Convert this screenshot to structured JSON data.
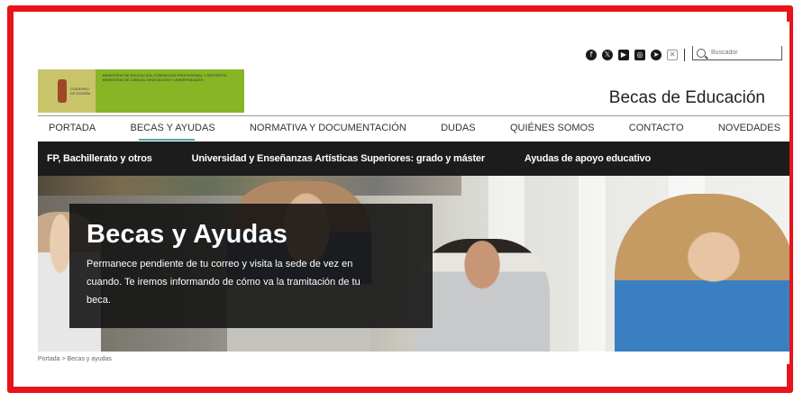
{
  "header": {
    "social": [
      {
        "icon": "facebook-icon",
        "glyph": "f"
      },
      {
        "icon": "x-twitter-icon",
        "glyph": "𝕏"
      },
      {
        "icon": "youtube-icon",
        "glyph": "▶"
      },
      {
        "icon": "instagram-icon",
        "glyph": "◎"
      },
      {
        "icon": "telegram-icon",
        "glyph": "➤"
      },
      {
        "icon": "flickr-icon",
        "glyph": "✕"
      }
    ],
    "search_placeholder": "Buscador",
    "site_title": "Becas de Educación",
    "logo": {
      "left_text": "GOBIERNO DE ESPAÑA",
      "right_text": "MINISTERIO DE EDUCACIÓN, FORMACIÓN PROFESIONAL Y DEPORTES MINISTERIO DE CIENCIA, INNOVACIÓN Y UNIVERSIDADES"
    }
  },
  "mainnav": [
    "PORTADA",
    "BECAS Y AYUDAS",
    "NORMATIVA Y DOCUMENTACIÓN",
    "DUDAS",
    "QUIÉNES SOMOS",
    "CONTACTO",
    "NOVEDADES"
  ],
  "subnav": [
    "FP, Bachillerato y otros",
    "Universidad y Enseñanzas Artísticas Superiores: grado y máster",
    "Ayudas de apoyo educativo"
  ],
  "hero": {
    "title": "Becas y Ayudas",
    "text": "Permanece pendiente de tu correo y visita la sede de vez en cuando. Te iremos informando de cómo va la tramitación de tu beca."
  },
  "breadcrumb": "Portada  >  Becas y ayudas",
  "colors": {
    "frame": "#e8141b",
    "accent": "#49a6b0",
    "subnav": "#1c1c1c",
    "logo": "#86b525"
  }
}
